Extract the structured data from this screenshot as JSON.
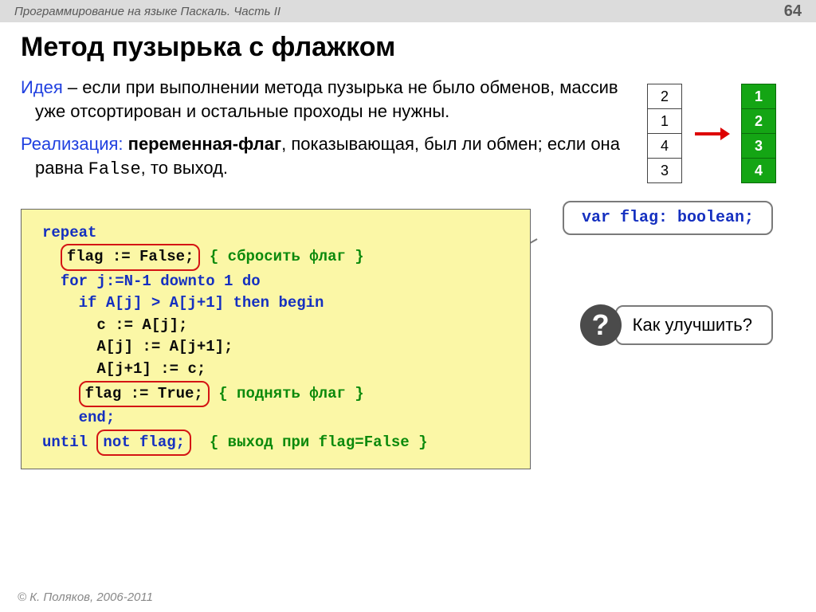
{
  "header": {
    "breadcrumb": "Программирование на языке Паскаль. Часть II",
    "page": "64"
  },
  "title": "Метод пузырька с флажком",
  "idea": {
    "label": "Идея",
    "text": " – если при выполнении метода пузырька не было обменов, массив уже отсортирован и остальные проходы не нужны."
  },
  "impl": {
    "label": "Реализация:",
    "text_before": " переменная-флаг",
    "text_mid": ", показывающая, был ли обмен; если она равна ",
    "false_kw": "False",
    "text_after": ", то выход."
  },
  "arrays": {
    "left": [
      "2",
      "1",
      "4",
      "3"
    ],
    "right": [
      "1",
      "2",
      "3",
      "4"
    ]
  },
  "callout": "var flag: boolean;",
  "code": {
    "l1": "repeat",
    "l2a": "flag := False;",
    "l2b": "{ сбросить флаг }",
    "l3": "for j:=N-1 downto 1 do",
    "l4": "if A[j] > A[j+1] then begin",
    "l5": "c := A[j];",
    "l6": "A[j] := A[j+1];",
    "l7": "A[j+1] := c;",
    "l8a": "flag := True;",
    "l8b": "{ поднять флаг }",
    "l9": "end;",
    "l10a": "until",
    "l10b": "not flag;",
    "l10c": "{ выход при flag=False }"
  },
  "improve": "Как улучшить?",
  "footer": "© К. Поляков, 2006-2011"
}
